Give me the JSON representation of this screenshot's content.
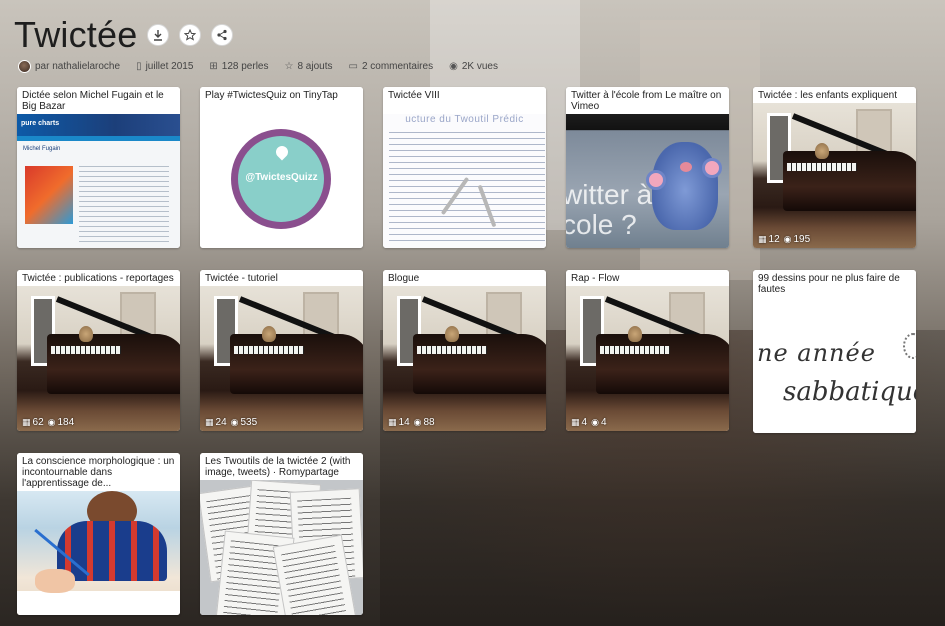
{
  "page": {
    "title": "Twictée",
    "buttons": [
      "download",
      "favorite",
      "share"
    ]
  },
  "meta": {
    "author": "par nathalielaroche",
    "date": "juillet 2015",
    "pearls": "128 perles",
    "additions": "8 ajouts",
    "comments": "2 commentaires",
    "views": "2K vues"
  },
  "doc_texts": {
    "heading": "ucture du Twoutil Prédic"
  },
  "video_texts": {
    "line1": "witter à",
    "line2": "cole ?"
  },
  "quiz_texts": {
    "logo": "@TwictesQuizz"
  },
  "sketch_texts": {
    "line1": "ne année",
    "line2": "sabbatique"
  },
  "web_texts": {
    "logo": "pure charts",
    "heading": "Michel Fugain"
  },
  "cards": [
    {
      "title": "Dictée selon Michel Fugain et le Big Bazar",
      "thumb": "web"
    },
    {
      "title": "Play #TwictesQuiz on TinyTap",
      "thumb": "quiz"
    },
    {
      "title": "Twictée VIII",
      "thumb": "doc"
    },
    {
      "title": "Twitter à l'école from Le maître on Vimeo",
      "thumb": "video"
    },
    {
      "title": "Twictée : les enfants expliquent",
      "thumb": "piano",
      "count": "12",
      "views": "195"
    },
    {
      "title": "Twictée : publications - reportages",
      "thumb": "piano",
      "count": "62",
      "views": "184"
    },
    {
      "title": "Twictée - tutoriel",
      "thumb": "piano",
      "count": "24",
      "views": "535"
    },
    {
      "title": "Blogue",
      "thumb": "piano",
      "count": "14",
      "views": "88"
    },
    {
      "title": "Rap - Flow",
      "thumb": "piano",
      "count": "4",
      "views": "4"
    },
    {
      "title": "99 dessins pour ne plus faire de fautes",
      "thumb": "sketch"
    },
    {
      "title": "La conscience morphologique : un incontournable dans l'apprentissage de...",
      "thumb": "child"
    },
    {
      "title": "Les Twoutils de la twictée 2 (with image, tweets) · Romypartage",
      "thumb": "sheets"
    }
  ],
  "colors": {
    "card_bg": "#ffffff",
    "title_text": "#1e1e1e",
    "meta_text": "#444444"
  },
  "icons": {
    "download": "download-icon",
    "favorite": "star-icon",
    "share": "share-icon",
    "stack": "grid-icon",
    "views": "eye-icon"
  }
}
